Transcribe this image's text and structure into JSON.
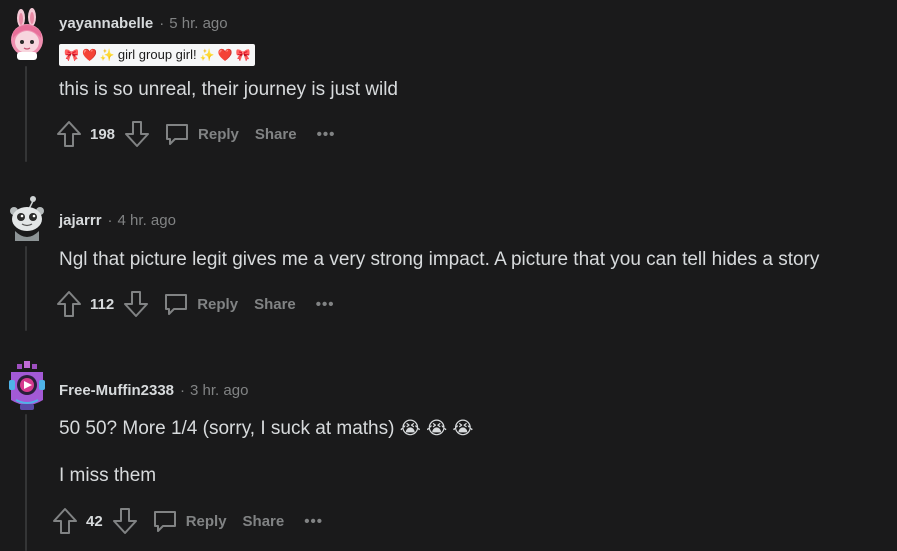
{
  "comments": [
    {
      "username": "yayannabelle",
      "separator": "·",
      "time": "5 hr. ago",
      "flair": {
        "text": "girl group girl!",
        "left_emojis": [
          "🎀",
          "❤️",
          "✨"
        ],
        "right_emojis": [
          "✨",
          "❤️",
          "🎀"
        ]
      },
      "body": [
        "this is so unreal, their journey is just wild"
      ],
      "score": "198",
      "reply_label": "Reply",
      "share_label": "Share",
      "more_label": "•••",
      "avatar": "pink-bunny-avatar"
    },
    {
      "username": "jajarrr",
      "separator": "·",
      "time": "4 hr. ago",
      "body": [
        "Ngl that picture legit gives me a very strong impact. A picture that you can tell hides a story"
      ],
      "score": "112",
      "reply_label": "Reply",
      "share_label": "Share",
      "more_label": "•••",
      "avatar": "grey-snoo-avatar"
    },
    {
      "username": "Free-Muffin2338",
      "separator": "·",
      "time": "3 hr. ago",
      "body": [
        "50 50? More 1/4 (sorry, I suck at maths)",
        "I miss them"
      ],
      "body_emojis": [
        "😭",
        "😭",
        "😭"
      ],
      "score": "42",
      "reply_label": "Reply",
      "share_label": "Share",
      "more_label": "•••",
      "avatar": "purple-robot-avatar"
    }
  ],
  "colors": {
    "background": "#1a1a1b",
    "text": "#d7dadc",
    "muted": "#818384",
    "thread_line": "#343536",
    "flair_bg": "#f6f7f8"
  }
}
